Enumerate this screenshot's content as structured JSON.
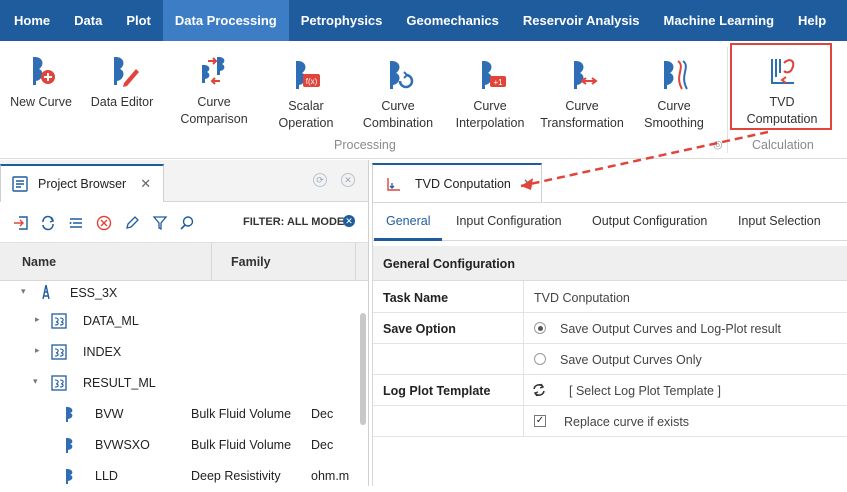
{
  "menu": {
    "items": [
      "Home",
      "Data",
      "Plot",
      "Data Processing",
      "Petrophysics",
      "Geomechanics",
      "Reservoir Analysis",
      "Machine Learning",
      "Help"
    ],
    "active_index": 3,
    "collapse_glyph": "▲"
  },
  "ribbon": {
    "new_curve": "New Curve",
    "data_editor": "Data Editor",
    "curve_comparison_1": "Curve",
    "curve_comparison_2": "Comparison",
    "scalar_operation_1": "Scalar",
    "scalar_operation_2": "Operation",
    "curve_combination_1": "Curve",
    "curve_combination_2": "Combination",
    "curve_interpolation_1": "Curve",
    "curve_interpolation_2": "Interpolation",
    "curve_transformation_1": "Curve",
    "curve_transformation_2": "Transformation",
    "curve_smoothing_1": "Curve",
    "curve_smoothing_2": "Smoothing",
    "tvd_computation_1": "TVD",
    "tvd_computation_2": "Computation",
    "group_processing": "Processing",
    "group_calculation": "Calculation"
  },
  "left_panel": {
    "tab_title": "Project Browser",
    "filter_label": "FILTER: ALL MODE",
    "columns": [
      "Name",
      "Family"
    ],
    "tree": [
      {
        "name": "ESS_3X",
        "family": "",
        "unit": "",
        "level": 0,
        "expander": "▾",
        "icon": "well-icon"
      },
      {
        "name": "DATA_ML",
        "family": "",
        "unit": "",
        "level": 1,
        "expander": "▸",
        "icon": "dataset-icon"
      },
      {
        "name": "INDEX",
        "family": "",
        "unit": "",
        "level": 1,
        "expander": "▸",
        "icon": "dataset-icon"
      },
      {
        "name": "RESULT_ML",
        "family": "",
        "unit": "",
        "level": 1,
        "expander": "▾",
        "icon": "dataset-icon"
      },
      {
        "name": "BVW",
        "family": "Bulk Fluid Volume",
        "unit": "Dec",
        "level": 2,
        "expander": "",
        "icon": "curve-icon"
      },
      {
        "name": "BVWSXO",
        "family": "Bulk Fluid Volume",
        "unit": "Dec",
        "level": 2,
        "expander": "",
        "icon": "curve-icon"
      },
      {
        "name": "LLD",
        "family": "Deep Resistivity",
        "unit": "ohm.m",
        "level": 2,
        "expander": "",
        "icon": "curve-icon"
      }
    ]
  },
  "right_panel": {
    "tab_title": "TVD Conputation",
    "subtabs": [
      "General",
      "Input Configuration",
      "Output Configuration",
      "Input Selection"
    ],
    "active_subtab": 0,
    "section_title": "General Configuration",
    "task_name_label": "Task Name",
    "task_name_value": "TVD Conputation",
    "save_option_label": "Save Option",
    "save_option_1": "Save Output Curves and Log-Plot result",
    "save_option_2": "Save Output Curves Only",
    "log_plot_label": "Log Plot Template",
    "log_plot_placeholder": "[ Select Log Plot Template ]",
    "replace_curve_label": "Replace curve if exists",
    "replace_curve_checked": true
  },
  "colors": {
    "menubar": "#1f5c9e",
    "menu_active": "#3d7dc5",
    "highlight_border": "#e0443a",
    "icon_blue": "#2f6db5",
    "icon_red": "#e0443a"
  }
}
